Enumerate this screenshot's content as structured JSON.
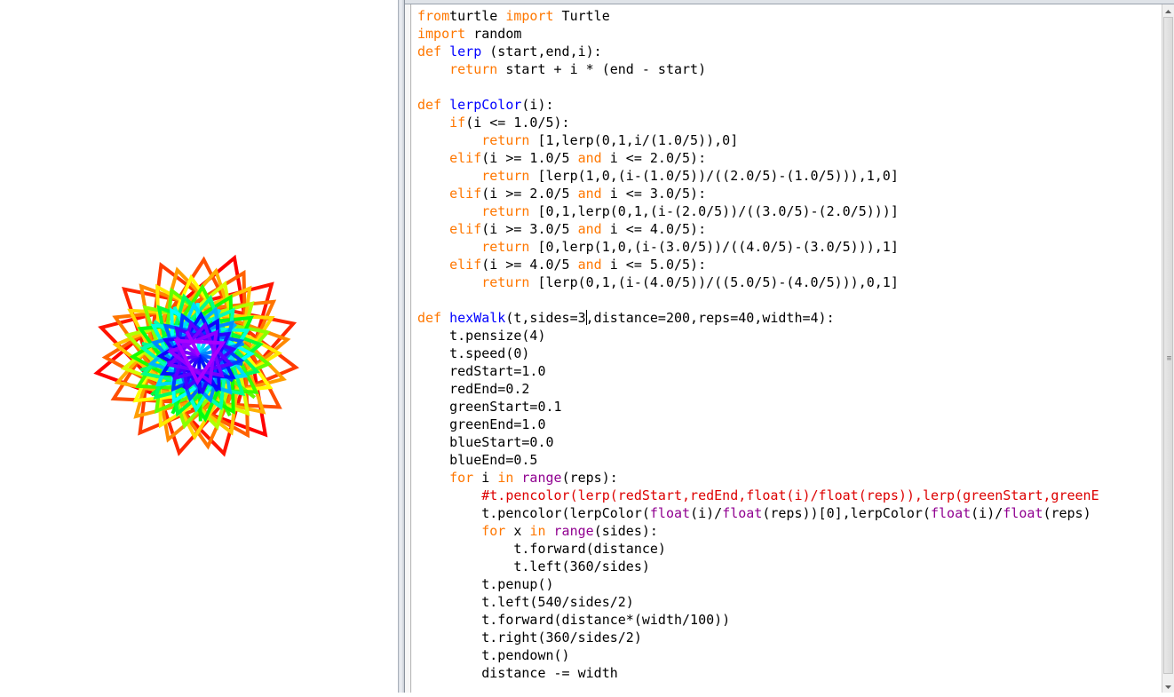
{
  "turtle": {
    "sides": 3,
    "distance": 200,
    "reps": 40,
    "width": 4,
    "colors": [
      "#ff0000",
      "#ff7f00",
      "#ffff00",
      "#00ff00",
      "#00ffff",
      "#0000ff",
      "#aa00ff"
    ]
  },
  "editor": {
    "code_lines": [
      [
        [
          "kw",
          "from"
        ],
        [
          "",
          "turtle "
        ],
        [
          "kw",
          "import"
        ],
        [
          "",
          " Turtle"
        ]
      ],
      [
        [
          "kw",
          "import"
        ],
        [
          "",
          " random"
        ]
      ],
      [
        [
          "kw",
          "def"
        ],
        [
          "",
          ""
        ],
        [
          "fn",
          " lerp"
        ],
        [
          "",
          " (start,end,i):"
        ]
      ],
      [
        [
          "",
          "    "
        ],
        [
          "kw",
          "return"
        ],
        [
          "",
          " start + i * (end - start)"
        ]
      ],
      [
        [
          "",
          ""
        ]
      ],
      [
        [
          "kw",
          "def"
        ],
        [
          "fn",
          " lerpColor"
        ],
        [
          "",
          "(i):"
        ]
      ],
      [
        [
          "",
          "    "
        ],
        [
          "kw",
          "if"
        ],
        [
          "",
          "(i <= 1.0/5):"
        ]
      ],
      [
        [
          "",
          "        "
        ],
        [
          "kw",
          "return"
        ],
        [
          "",
          " [1,lerp(0,1,i/(1.0/5)),0]"
        ]
      ],
      [
        [
          "",
          "    "
        ],
        [
          "kw",
          "elif"
        ],
        [
          "",
          "(i >= 1.0/5 "
        ],
        [
          "kw",
          "and"
        ],
        [
          "",
          " i <= 2.0/5):"
        ]
      ],
      [
        [
          "",
          "        "
        ],
        [
          "kw",
          "return"
        ],
        [
          "",
          " [lerp(1,0,(i-(1.0/5))/((2.0/5)-(1.0/5))),1,0]"
        ]
      ],
      [
        [
          "",
          "    "
        ],
        [
          "kw",
          "elif"
        ],
        [
          "",
          "(i >= 2.0/5 "
        ],
        [
          "kw",
          "and"
        ],
        [
          "",
          " i <= 3.0/5):"
        ]
      ],
      [
        [
          "",
          "        "
        ],
        [
          "kw",
          "return"
        ],
        [
          "",
          " [0,1,lerp(0,1,(i-(2.0/5))/((3.0/5)-(2.0/5)))]"
        ]
      ],
      [
        [
          "",
          "    "
        ],
        [
          "kw",
          "elif"
        ],
        [
          "",
          "(i >= 3.0/5 "
        ],
        [
          "kw",
          "and"
        ],
        [
          "",
          " i <= 4.0/5):"
        ]
      ],
      [
        [
          "",
          "        "
        ],
        [
          "kw",
          "return"
        ],
        [
          "",
          " [0,lerp(1,0,(i-(3.0/5))/((4.0/5)-(3.0/5))),1]"
        ]
      ],
      [
        [
          "",
          "    "
        ],
        [
          "kw",
          "elif"
        ],
        [
          "",
          "(i >= 4.0/5 "
        ],
        [
          "kw",
          "and"
        ],
        [
          "",
          " i <= 5.0/5):"
        ]
      ],
      [
        [
          "",
          "        "
        ],
        [
          "kw",
          "return"
        ],
        [
          "",
          " [lerp(0,1,(i-(4.0/5))/((5.0/5)-(4.0/5))),0,1]"
        ]
      ],
      [
        [
          "",
          ""
        ]
      ],
      [
        [
          "kw",
          "def"
        ],
        [
          "fn",
          " hexWalk"
        ],
        [
          "",
          "(t,sides=3"
        ],
        [
          "caret",
          ""
        ],
        [
          "",
          ",distance=200,reps=40,width=4):"
        ]
      ],
      [
        [
          "",
          "    t.pensize(4)"
        ]
      ],
      [
        [
          "",
          "    t.speed(0)"
        ]
      ],
      [
        [
          "",
          "    redStart=1.0"
        ]
      ],
      [
        [
          "",
          "    redEnd=0.2"
        ]
      ],
      [
        [
          "",
          "    greenStart=0.1"
        ]
      ],
      [
        [
          "",
          "    greenEnd=1.0"
        ]
      ],
      [
        [
          "",
          "    blueStart=0.0"
        ]
      ],
      [
        [
          "",
          "    blueEnd=0.5"
        ]
      ],
      [
        [
          "",
          "    "
        ],
        [
          "kw",
          "for"
        ],
        [
          "",
          " i "
        ],
        [
          "kw",
          "in"
        ],
        [
          "bi",
          " range"
        ],
        [
          "",
          "(reps):"
        ]
      ],
      [
        [
          "",
          "        "
        ],
        [
          "cm",
          "#t.pencolor(lerp(redStart,redEnd,float(i)/float(reps)),lerp(greenStart,greenE"
        ]
      ],
      [
        [
          "",
          "        t.pencolor(lerpColor("
        ],
        [
          "bi",
          "float"
        ],
        [
          "",
          "(i)/"
        ],
        [
          "bi",
          "float"
        ],
        [
          "",
          "(reps))[0],lerpColor("
        ],
        [
          "bi",
          "float"
        ],
        [
          "",
          "(i)/"
        ],
        [
          "bi",
          "float"
        ],
        [
          "",
          "(reps)"
        ]
      ],
      [
        [
          "",
          "        "
        ],
        [
          "kw",
          "for"
        ],
        [
          "",
          " x "
        ],
        [
          "kw",
          "in"
        ],
        [
          "bi",
          " range"
        ],
        [
          "",
          "(sides):"
        ]
      ],
      [
        [
          "",
          "            t.forward(distance)"
        ]
      ],
      [
        [
          "",
          "            t.left(360/sides)"
        ]
      ],
      [
        [
          "",
          "        t.penup()"
        ]
      ],
      [
        [
          "",
          "        t.left(540/sides/2)"
        ]
      ],
      [
        [
          "",
          "        t.forward(distance*(width/100))"
        ]
      ],
      [
        [
          "",
          "        t.right(360/sides/2)"
        ]
      ],
      [
        [
          "",
          "        t.pendown()"
        ]
      ],
      [
        [
          "",
          "        distance -= width"
        ]
      ]
    ]
  },
  "scrollbar": {
    "grip_glyph": "≡"
  }
}
